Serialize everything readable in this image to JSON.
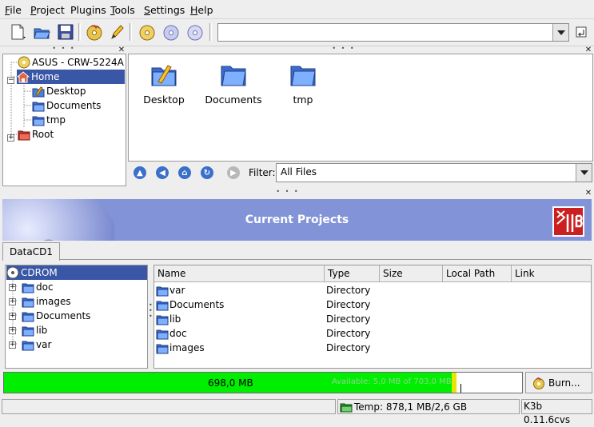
{
  "menu": [
    {
      "pre": "",
      "ul": "F",
      "post": "ile"
    },
    {
      "pre": "",
      "ul": "P",
      "post": "roject"
    },
    {
      "pre": "Plu",
      "ul": "g",
      "post": "ins"
    },
    {
      "pre": "",
      "ul": "T",
      "post": "ools"
    },
    {
      "pre": "",
      "ul": "S",
      "post": "ettings"
    },
    {
      "pre": "",
      "ul": "H",
      "post": "elp"
    }
  ],
  "location_value": "",
  "dir_tree": [
    {
      "label": "ASUS - CRW-5224A",
      "icon": "cdrom-drive-icon"
    },
    {
      "label": "Home",
      "icon": "home-icon",
      "selected": true
    },
    {
      "label": "Desktop",
      "icon": "desktop-folder-icon"
    },
    {
      "label": "Documents",
      "icon": "folder-icon"
    },
    {
      "label": "tmp",
      "icon": "folder-icon"
    },
    {
      "label": "Root",
      "icon": "root-folder-icon"
    }
  ],
  "file_icons": [
    {
      "label": "Desktop",
      "icon": "desktop-folder-icon"
    },
    {
      "label": "Documents",
      "icon": "folder-icon"
    },
    {
      "label": "tmp",
      "icon": "folder-icon"
    }
  ],
  "filter": {
    "label": "Filter:",
    "value": "All Files"
  },
  "projects_header": {
    "title": "Current Projects",
    "logo_text": "K3B"
  },
  "project_tab": "DataCD1",
  "project_tree": [
    {
      "label": "CDROM",
      "selected": true
    },
    {
      "label": "doc"
    },
    {
      "label": "images"
    },
    {
      "label": "Documents"
    },
    {
      "label": "lib"
    },
    {
      "label": "var"
    }
  ],
  "table": {
    "columns": [
      "Name",
      "Type",
      "Size",
      "Local Path",
      "Link"
    ],
    "rows": [
      {
        "name": "var",
        "type": "Directory"
      },
      {
        "name": "Documents",
        "type": "Directory"
      },
      {
        "name": "lib",
        "type": "Directory"
      },
      {
        "name": "doc",
        "type": "Directory"
      },
      {
        "name": "images",
        "type": "Directory"
      }
    ]
  },
  "capacity": {
    "used_label": "698,0 MB",
    "available_label": "Available: 5,0 MB of 703,0 MB",
    "fill_fraction": 0.993
  },
  "burn_label": "Burn...",
  "status": {
    "temp": "Temp: 878,1 MB/2,6 GB",
    "version": "K3b 0.11.6cvs"
  },
  "colors": {
    "selection": "#3a56a6",
    "capacity_green": "#00ee00",
    "capacity_yellow": "#e6e600",
    "header_blue": "#8293d8",
    "k3b_red": "#cc1f1f"
  }
}
